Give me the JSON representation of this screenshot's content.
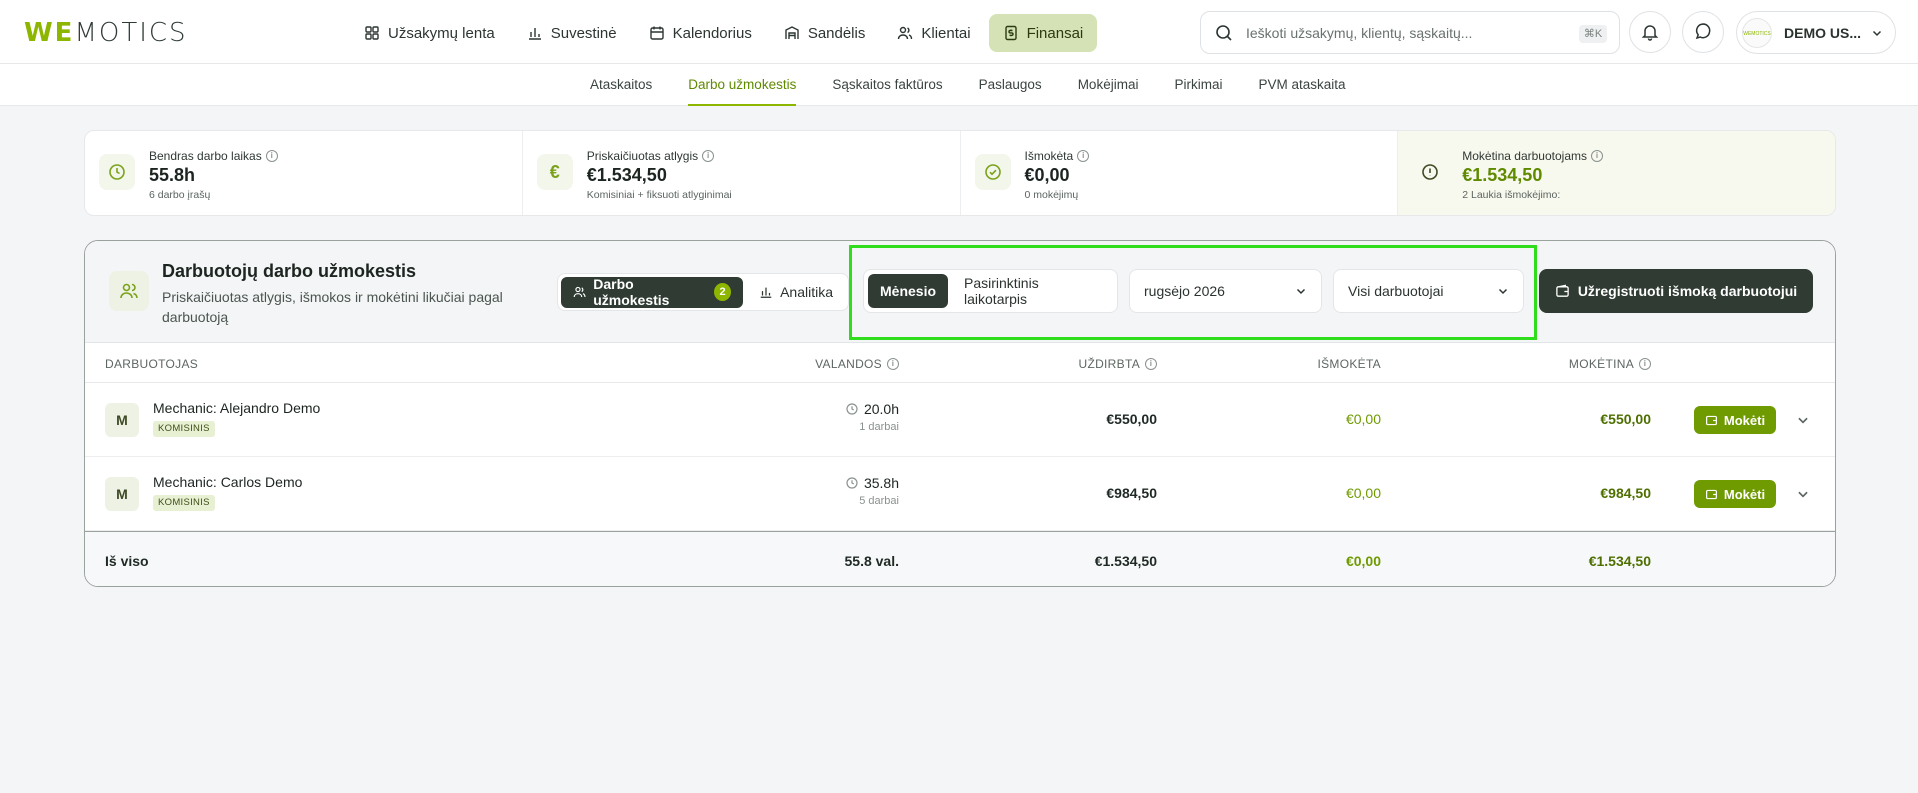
{
  "brand": {
    "logo_we": "WE",
    "logo_rest": "MOTICS"
  },
  "mainnav": [
    {
      "label": "Užsakymų lenta",
      "icon": "grid-icon"
    },
    {
      "label": "Suvestinė",
      "icon": "bar-chart-icon"
    },
    {
      "label": "Kalendorius",
      "icon": "calendar-icon"
    },
    {
      "label": "Sandėlis",
      "icon": "warehouse-icon"
    },
    {
      "label": "Klientai",
      "icon": "users-icon"
    },
    {
      "label": "Finansai",
      "icon": "dollar-doc-icon",
      "active": true
    }
  ],
  "search": {
    "placeholder": "Ieškoti užsakymų, klientų, sąskaitų...",
    "shortcut": "⌘K"
  },
  "user": {
    "name": "DEMO US...",
    "avatar_text": "WEMOTICS"
  },
  "subnav": [
    {
      "label": "Ataskaitos"
    },
    {
      "label": "Darbo užmokestis",
      "active": true
    },
    {
      "label": "Sąskaitos faktūros"
    },
    {
      "label": "Paslaugos"
    },
    {
      "label": "Mokėjimai"
    },
    {
      "label": "Pirkimai"
    },
    {
      "label": "PVM ataskaita"
    }
  ],
  "stats": [
    {
      "label": "Bendras darbo laikas",
      "value": "55.8h",
      "sub": "6 darbo įrašų",
      "icon": "clock-icon"
    },
    {
      "label": "Priskaičiuotas atlygis",
      "value": "€1.534,50",
      "sub": "Komisiniai + fiksuoti atlyginimai",
      "icon": "euro-icon"
    },
    {
      "label": "Išmokėta",
      "value": "€0,00",
      "sub": "0 mokėjimų",
      "icon": "check-circle-icon"
    },
    {
      "label": "Mokėtina darbuotojams",
      "value": "€1.534,50",
      "sub": "2 Laukia išmokėjimo:",
      "icon": "alert-circle-icon"
    }
  ],
  "panel": {
    "title": "Darbuotojų darbo užmokestis",
    "subtitle": "Priskaičiuotas atlygis, išmokos ir mokėtini likučiai pagal darbuotoją",
    "view_tabs": {
      "payroll": "Darbo užmokestis",
      "payroll_count": "2",
      "analytics": "Analitika"
    },
    "period_tabs": {
      "monthly": "Mėnesio",
      "custom": "Pasirinktinis laikotarpis"
    },
    "month_select": "rugsėjo 2026",
    "employee_select": "Visi darbuotojai",
    "register_button": "Užregistruoti išmoką darbuotojui"
  },
  "table": {
    "headers": {
      "employee": "DARBUOTOJAS",
      "hours": "VALANDOS",
      "earned": "UŽDIRBTA",
      "paid": "IŠMOKĖTA",
      "payable": "MOKĖTINA"
    },
    "rows": [
      {
        "initial": "M",
        "name": "Mechanic: Alejandro Demo",
        "tag": "KOMISINIS",
        "hours": "20.0h",
        "jobs": "1 darbai",
        "earned": "€550,00",
        "paid": "€0,00",
        "payable": "€550,00",
        "pay_button": "Mokėti"
      },
      {
        "initial": "M",
        "name": "Mechanic: Carlos Demo",
        "tag": "KOMISINIS",
        "hours": "35.8h",
        "jobs": "5 darbai",
        "earned": "€984,50",
        "paid": "€0,00",
        "payable": "€984,50",
        "pay_button": "Mokėti"
      }
    ],
    "total": {
      "label": "Iš viso",
      "hours": "55.8 val.",
      "earned": "€1.534,50",
      "paid": "€0,00",
      "payable": "€1.534,50"
    }
  },
  "colors": {
    "accent": "#8db600",
    "dark": "#2f3b33",
    "highlight": "#2fdd1c"
  }
}
